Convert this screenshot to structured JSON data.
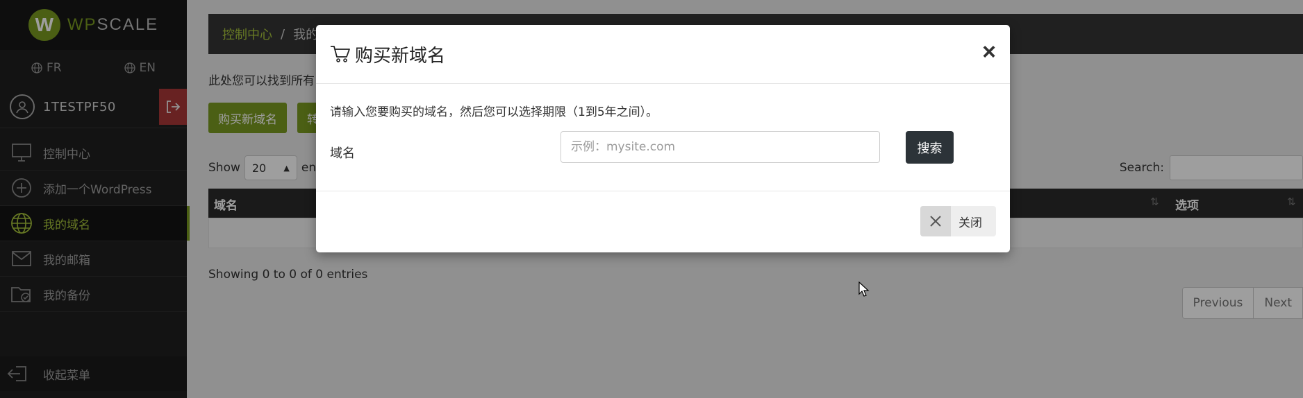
{
  "brand": {
    "logo_letter": "W",
    "name_accent": "WP",
    "name_rest": "SCALE",
    "accent_color": "#7a9a21"
  },
  "languages": [
    {
      "code": "FR",
      "icon": "globe-icon"
    },
    {
      "code": "EN",
      "icon": "globe-icon"
    }
  ],
  "user": {
    "name": "1TESTPF50"
  },
  "nav": {
    "items": [
      {
        "label": "控制中心",
        "icon": "monitor-icon",
        "active": false
      },
      {
        "label": "添加一个WordPress",
        "icon": "plus-circle-icon",
        "active": false
      },
      {
        "label": "我的域名",
        "icon": "globe-icon",
        "active": true
      },
      {
        "label": "我的邮箱",
        "icon": "envelope-icon",
        "active": false
      },
      {
        "label": "我的备份",
        "icon": "backup-icon",
        "active": false
      }
    ],
    "collapse_label": "收起菜单"
  },
  "breadcrumb": {
    "home": "控制中心",
    "separator": "/",
    "current": "我的"
  },
  "intro_text": "此处您可以找到所有",
  "buttons": {
    "buy_domain": "购买新域名",
    "second": "转"
  },
  "table": {
    "show_label": "Show",
    "page_size": "20",
    "entries_label": "en",
    "search_label": "Search:",
    "columns": [
      "域名",
      "选项"
    ],
    "info": "Showing 0 to 0 of 0 entries",
    "pagination": {
      "previous": "Previous",
      "next": "Next"
    }
  },
  "modal": {
    "title": "购买新域名",
    "close_symbol": "×",
    "description": "请输入您要购买的域名，然后您可以选择期限（1到5年之间）。",
    "field_label": "域名",
    "input_placeholder": "示例：mysite.com",
    "input_value": "",
    "search_button": "搜索",
    "close_button": "关闭"
  }
}
